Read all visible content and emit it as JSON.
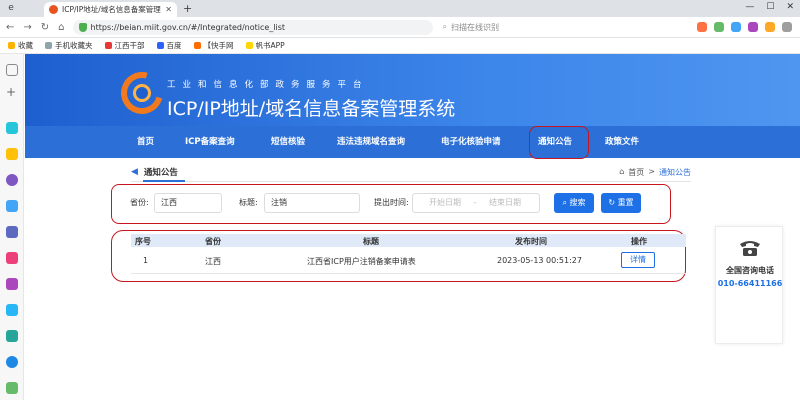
{
  "browser": {
    "tab_title": "ICP/IP地址/域名信息备案管理",
    "url": "https://beian.miit.gov.cn/#/Integrated/notice_list",
    "search_text": "扫描在线识别",
    "bookmarks": [
      "收藏",
      "手机收藏夹",
      "江西干部",
      "百度",
      "【快手网",
      "帆书APP"
    ]
  },
  "header": {
    "ministry": "工业和信息化部政务服务平台",
    "system_title": "ICP/IP地址/域名信息备案管理系统"
  },
  "nav": {
    "items": [
      "首页",
      "ICP备案查询",
      "短信核验",
      "违法违规域名查询",
      "电子化核验申请",
      "通知公告",
      "政策文件"
    ]
  },
  "breadcrumb": {
    "section": "通知公告",
    "home": "首页",
    "sep": ">",
    "current": "通知公告"
  },
  "filters": {
    "province_label": "省份:",
    "province_value": "江西",
    "title_label": "标题:",
    "title_value": "注销",
    "time_label": "提出时间:",
    "start_placeholder": "开始日期",
    "dash": "-",
    "end_placeholder": "结束日期",
    "search_button": "搜索",
    "reset_button": "重置"
  },
  "table": {
    "columns": [
      "序号",
      "省份",
      "标题",
      "发布时间",
      "操作"
    ],
    "rows": [
      {
        "index": "1",
        "province": "江西",
        "title": "江西省ICP用户注销备案申请表",
        "time": "2023-05-13 00:51:27",
        "action": "详情"
      }
    ]
  },
  "hotline": {
    "label": "全国咨询电话",
    "number": "010-66411166"
  },
  "colors": {
    "brand_blue": "#2b6fd7",
    "button_blue": "#1e70e6",
    "highlight_red": "#c7161e",
    "logo_orange": "#f07a1d"
  }
}
